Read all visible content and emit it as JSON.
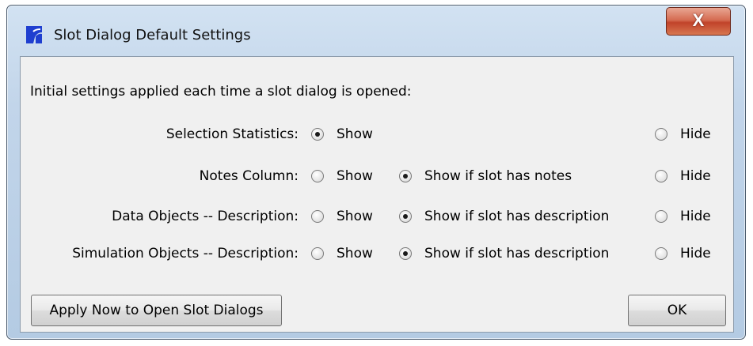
{
  "window": {
    "title": "Slot Dialog Default Settings",
    "close_label": "X",
    "app_icon": "riverware-logo-icon"
  },
  "intro_text": "Initial settings applied each time a slot dialog is opened:",
  "settings": [
    {
      "label": "Selection Statistics:",
      "options": [
        {
          "label": "Show",
          "checked": true
        },
        null,
        {
          "label": "Hide",
          "checked": false
        }
      ]
    },
    {
      "label": "Notes Column:",
      "options": [
        {
          "label": "Show",
          "checked": false
        },
        {
          "label": "Show if slot has notes",
          "checked": true
        },
        {
          "label": "Hide",
          "checked": false
        }
      ]
    },
    {
      "label": "Data Objects -- Description:",
      "options": [
        {
          "label": "Show",
          "checked": false
        },
        {
          "label": "Show if slot has description",
          "checked": true
        },
        {
          "label": "Hide",
          "checked": false
        }
      ]
    },
    {
      "label": "Simulation Objects -- Description:",
      "options": [
        {
          "label": "Show",
          "checked": false
        },
        {
          "label": "Show if slot has description",
          "checked": true
        },
        {
          "label": "Hide",
          "checked": false
        }
      ]
    }
  ],
  "buttons": {
    "apply_label": "Apply Now to Open Slot Dialogs",
    "ok_label": "OK"
  },
  "colors": {
    "close_button": "#c9503a",
    "frame": "#c2d5ea",
    "client_bg": "#f0f0f0",
    "logo_blue": "#1f3fd0"
  }
}
